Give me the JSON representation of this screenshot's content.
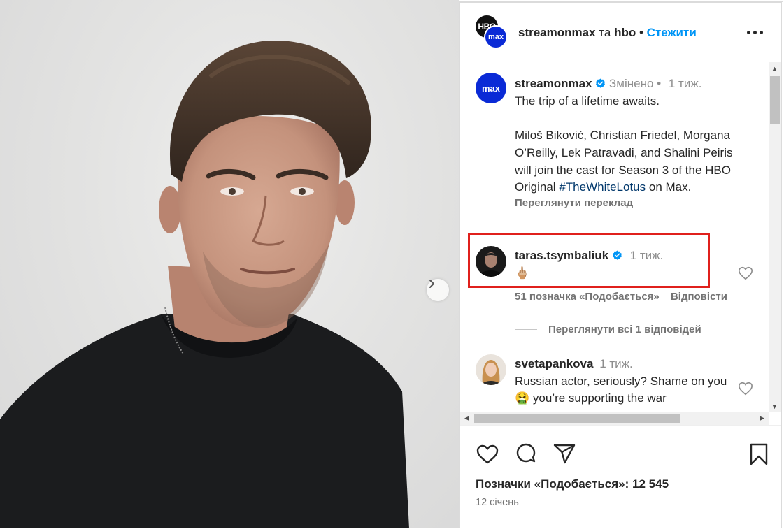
{
  "post_header": {
    "hbo_avatar_text": "HBO",
    "max_avatar_text": "max",
    "account1": "streamonmax",
    "connector": "та",
    "account2": "hbo",
    "separator": "•",
    "follow_label": "Стежити"
  },
  "caption": {
    "avatar_text": "max",
    "username": "streamonmax",
    "edited": "Змінено",
    "dot": "•",
    "time": "1 тиж.",
    "line1": "The trip of a lifetime awaits.",
    "body": "Miloš Biković, Christian Friedel, Morgana O’Reilly, Lek Patravadi, and Shalini Peiris will join the cast for Season 3 of the HBO Original",
    "hashtag": "#TheWhiteLotus",
    "tail": "on Max.",
    "translate": "Переглянути переклад"
  },
  "comment1": {
    "username": "taras.tsymbaliuk",
    "time": "1 тиж.",
    "text": "🖕🏼",
    "likes": "51 позначка «Подобається»",
    "reply": "Відповісти",
    "view_replies": "Переглянути всі 1 відповідей"
  },
  "comment2": {
    "username": "svetapankova",
    "time": "1 тиж.",
    "text_before": "Russian actor, seriously? Shame on you",
    "emoji": "🤮",
    "text_after": "you’re supporting the war"
  },
  "footer": {
    "likes_label": "Позначки «Подобається»: 12 545",
    "date": "12 січень"
  },
  "icons": [
    "heart-icon",
    "comment-icon",
    "share-icon",
    "bookmark-icon",
    "more-options-icon",
    "chevron-right-icon",
    "verified-icon"
  ],
  "colors": {
    "follow_blue": "#0095f6",
    "hashtag": "#00376b",
    "highlight_red": "#e0201c",
    "verified_blue": "#0095f6",
    "max_blue": "#0a2ad6"
  }
}
